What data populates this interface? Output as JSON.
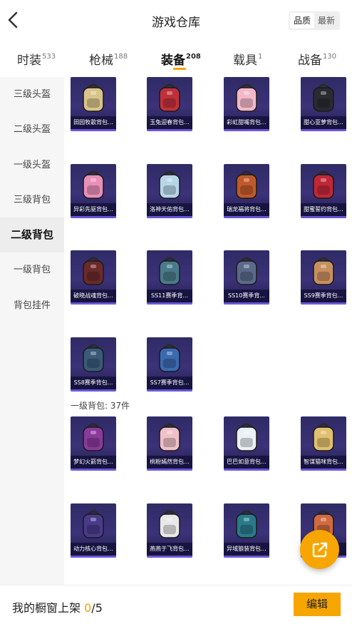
{
  "header": {
    "title": "游戏仓库",
    "sort_options": [
      "品质",
      "最新"
    ],
    "sort_active": "品质"
  },
  "tabs": [
    {
      "label": "时装",
      "count": "533"
    },
    {
      "label": "枪械",
      "count": "188"
    },
    {
      "label": "装备",
      "count": "208"
    },
    {
      "label": "载具",
      "count": "1"
    },
    {
      "label": "战备",
      "count": "130"
    }
  ],
  "sidebar": {
    "items": [
      "三级头盔",
      "二级头盔",
      "一级头盔",
      "三级背包",
      "二级背包",
      "一级背包",
      "背包挂件"
    ]
  },
  "content": {
    "level2_items": [
      {
        "name": "田园牧歌背包...",
        "color": "#d8c48a"
      },
      {
        "name": "玉兔迎春背包...",
        "color": "#c0303a"
      },
      {
        "name": "彩虹甜嘴背包...",
        "color": "#f2b8c8"
      },
      {
        "name": "甜心亚萝背包...",
        "color": "#2a2a32"
      },
      {
        "name": "异彩先驱背包...",
        "color": "#e890b8"
      },
      {
        "name": "洛神天佑背包...",
        "color": "#b8d6e8"
      },
      {
        "name": "瑞龙福将背包...",
        "color": "#c05a2a"
      },
      {
        "name": "甜蜜誓约背包...",
        "color": "#c02838"
      },
      {
        "name": "破晓战魂背包...",
        "color": "#6a2a2a"
      },
      {
        "name": "SS11赛季背...",
        "color": "#4a7a8a"
      },
      {
        "name": "SS10赛季背...",
        "color": "#5a6a8a"
      },
      {
        "name": "SS9赛季背包...",
        "color": "#c89060"
      },
      {
        "name": "SS8赛季背包...",
        "color": "#3a5a7a"
      },
      {
        "name": "SS7赛季背包...",
        "color": "#3a6ab0"
      }
    ],
    "level1_label": "一级背包: 37件",
    "level1_items": [
      {
        "name": "梦幻火箭背包...",
        "color": "#8a3a9a"
      },
      {
        "name": "桃粉嫣然背包...",
        "color": "#f0c0c8"
      },
      {
        "name": "巴巴如意背包...",
        "color": "#eaf0f4"
      },
      {
        "name": "智谋猫咪背包...",
        "color": "#e0c070"
      },
      {
        "name": "动力核心背包...",
        "color": "#4a3a8a"
      },
      {
        "name": "燕燕于飞背包...",
        "color": "#e8e8e8"
      },
      {
        "name": "异域狼装背包...",
        "color": "#2a7a8a"
      },
      {
        "name": "",
        "color": "#d06a40"
      }
    ]
  },
  "footer": {
    "label": "我的橱窗上架",
    "current": "0",
    "total": "/5",
    "edit_label": "编辑"
  }
}
